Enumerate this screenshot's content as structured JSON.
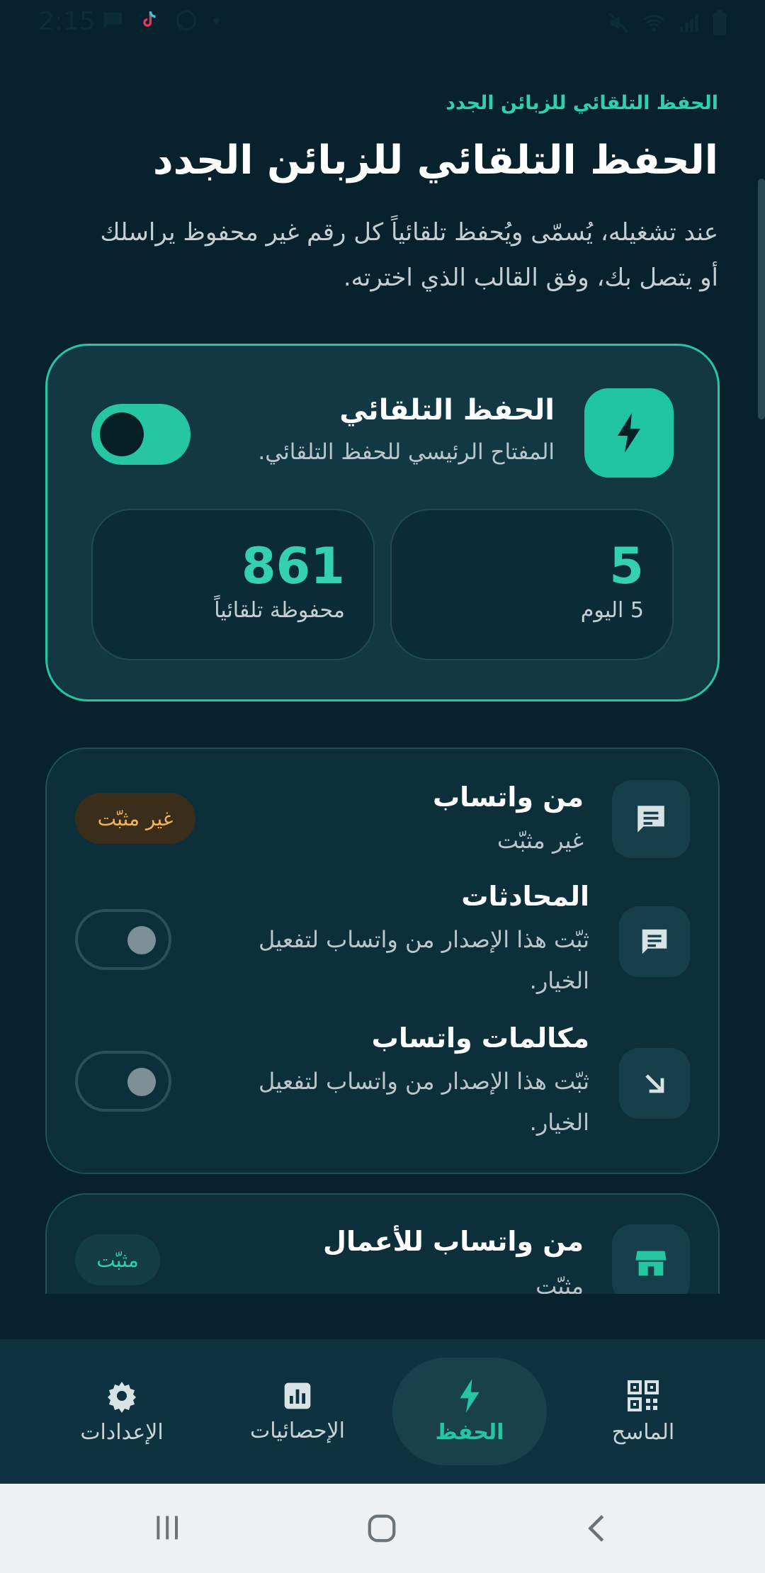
{
  "status_bar": {
    "time": "2:15",
    "left_icons": [
      "message-icon",
      "tiktok-icon",
      "whatsapp-icon",
      "dot-icon"
    ],
    "right_icons": [
      "mute-icon",
      "wifi-icon",
      "signal-icon",
      "battery-icon"
    ]
  },
  "header": {
    "eyebrow": "الحفظ التلقائي للزبائن الجدد",
    "title": "الحفظ التلقائي للزبائن الجدد",
    "description": "عند تشغيله، يُسمّى ويُحفظ تلقائياً كل رقم غير محفوظ يراسلك أو يتصل بك، وفق القالب الذي اخترته."
  },
  "autosave_card": {
    "icon": "bolt-icon",
    "title": "الحفظ التلقائي",
    "subtitle": "المفتاح الرئيسي للحفظ التلقائي.",
    "enabled": true,
    "stats": [
      {
        "value": "5",
        "label": "5 اليوم"
      },
      {
        "value": "861",
        "label": "محفوظة تلقائياً"
      }
    ]
  },
  "whatsapp_card": {
    "title": "من واتساب",
    "status": "غير مثبّت",
    "badge": "غير مثبّت",
    "rows": [
      {
        "title": "المحادثات",
        "subtitle": "ثبّت هذا الإصدار من واتساب لتفعيل الخيار.",
        "enabled": false
      },
      {
        "title": "مكالمات واتساب",
        "subtitle": "ثبّت هذا الإصدار من واتساب لتفعيل الخيار.",
        "enabled": false
      }
    ]
  },
  "business_card": {
    "title": "من واتساب للأعمال",
    "status": "مثبّت",
    "badge": "مثبّت"
  },
  "bottom_nav": {
    "items": [
      {
        "label": "الإعدادات",
        "icon": "gear-icon"
      },
      {
        "label": "الإحصائيات",
        "icon": "stats-icon"
      },
      {
        "label": "الحفظ",
        "icon": "bolt-icon",
        "active": true
      },
      {
        "label": "الماسح",
        "icon": "qr-icon"
      }
    ]
  },
  "colors": {
    "accent": "#27c6a3",
    "background": "#07222c",
    "card": "#123844",
    "warning": "#f0b45a"
  }
}
